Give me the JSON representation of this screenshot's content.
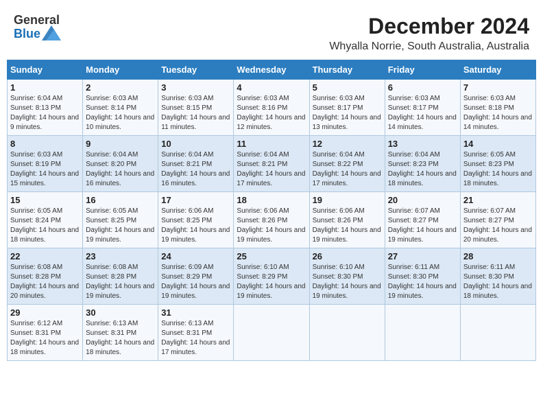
{
  "header": {
    "logo_general": "General",
    "logo_blue": "Blue",
    "month": "December 2024",
    "location": "Whyalla Norrie, South Australia, Australia"
  },
  "weekdays": [
    "Sunday",
    "Monday",
    "Tuesday",
    "Wednesday",
    "Thursday",
    "Friday",
    "Saturday"
  ],
  "weeks": [
    [
      {
        "day": "1",
        "sunrise": "Sunrise: 6:04 AM",
        "sunset": "Sunset: 8:13 PM",
        "daylight": "Daylight: 14 hours and 9 minutes."
      },
      {
        "day": "2",
        "sunrise": "Sunrise: 6:03 AM",
        "sunset": "Sunset: 8:14 PM",
        "daylight": "Daylight: 14 hours and 10 minutes."
      },
      {
        "day": "3",
        "sunrise": "Sunrise: 6:03 AM",
        "sunset": "Sunset: 8:15 PM",
        "daylight": "Daylight: 14 hours and 11 minutes."
      },
      {
        "day": "4",
        "sunrise": "Sunrise: 6:03 AM",
        "sunset": "Sunset: 8:16 PM",
        "daylight": "Daylight: 14 hours and 12 minutes."
      },
      {
        "day": "5",
        "sunrise": "Sunrise: 6:03 AM",
        "sunset": "Sunset: 8:17 PM",
        "daylight": "Daylight: 14 hours and 13 minutes."
      },
      {
        "day": "6",
        "sunrise": "Sunrise: 6:03 AM",
        "sunset": "Sunset: 8:17 PM",
        "daylight": "Daylight: 14 hours and 14 minutes."
      },
      {
        "day": "7",
        "sunrise": "Sunrise: 6:03 AM",
        "sunset": "Sunset: 8:18 PM",
        "daylight": "Daylight: 14 hours and 14 minutes."
      }
    ],
    [
      {
        "day": "8",
        "sunrise": "Sunrise: 6:03 AM",
        "sunset": "Sunset: 8:19 PM",
        "daylight": "Daylight: 14 hours and 15 minutes."
      },
      {
        "day": "9",
        "sunrise": "Sunrise: 6:04 AM",
        "sunset": "Sunset: 8:20 PM",
        "daylight": "Daylight: 14 hours and 16 minutes."
      },
      {
        "day": "10",
        "sunrise": "Sunrise: 6:04 AM",
        "sunset": "Sunset: 8:21 PM",
        "daylight": "Daylight: 14 hours and 16 minutes."
      },
      {
        "day": "11",
        "sunrise": "Sunrise: 6:04 AM",
        "sunset": "Sunset: 8:21 PM",
        "daylight": "Daylight: 14 hours and 17 minutes."
      },
      {
        "day": "12",
        "sunrise": "Sunrise: 6:04 AM",
        "sunset": "Sunset: 8:22 PM",
        "daylight": "Daylight: 14 hours and 17 minutes."
      },
      {
        "day": "13",
        "sunrise": "Sunrise: 6:04 AM",
        "sunset": "Sunset: 8:23 PM",
        "daylight": "Daylight: 14 hours and 18 minutes."
      },
      {
        "day": "14",
        "sunrise": "Sunrise: 6:05 AM",
        "sunset": "Sunset: 8:23 PM",
        "daylight": "Daylight: 14 hours and 18 minutes."
      }
    ],
    [
      {
        "day": "15",
        "sunrise": "Sunrise: 6:05 AM",
        "sunset": "Sunset: 8:24 PM",
        "daylight": "Daylight: 14 hours and 18 minutes."
      },
      {
        "day": "16",
        "sunrise": "Sunrise: 6:05 AM",
        "sunset": "Sunset: 8:25 PM",
        "daylight": "Daylight: 14 hours and 19 minutes."
      },
      {
        "day": "17",
        "sunrise": "Sunrise: 6:06 AM",
        "sunset": "Sunset: 8:25 PM",
        "daylight": "Daylight: 14 hours and 19 minutes."
      },
      {
        "day": "18",
        "sunrise": "Sunrise: 6:06 AM",
        "sunset": "Sunset: 8:26 PM",
        "daylight": "Daylight: 14 hours and 19 minutes."
      },
      {
        "day": "19",
        "sunrise": "Sunrise: 6:06 AM",
        "sunset": "Sunset: 8:26 PM",
        "daylight": "Daylight: 14 hours and 19 minutes."
      },
      {
        "day": "20",
        "sunrise": "Sunrise: 6:07 AM",
        "sunset": "Sunset: 8:27 PM",
        "daylight": "Daylight: 14 hours and 19 minutes."
      },
      {
        "day": "21",
        "sunrise": "Sunrise: 6:07 AM",
        "sunset": "Sunset: 8:27 PM",
        "daylight": "Daylight: 14 hours and 20 minutes."
      }
    ],
    [
      {
        "day": "22",
        "sunrise": "Sunrise: 6:08 AM",
        "sunset": "Sunset: 8:28 PM",
        "daylight": "Daylight: 14 hours and 20 minutes."
      },
      {
        "day": "23",
        "sunrise": "Sunrise: 6:08 AM",
        "sunset": "Sunset: 8:28 PM",
        "daylight": "Daylight: 14 hours and 19 minutes."
      },
      {
        "day": "24",
        "sunrise": "Sunrise: 6:09 AM",
        "sunset": "Sunset: 8:29 PM",
        "daylight": "Daylight: 14 hours and 19 minutes."
      },
      {
        "day": "25",
        "sunrise": "Sunrise: 6:10 AM",
        "sunset": "Sunset: 8:29 PM",
        "daylight": "Daylight: 14 hours and 19 minutes."
      },
      {
        "day": "26",
        "sunrise": "Sunrise: 6:10 AM",
        "sunset": "Sunset: 8:30 PM",
        "daylight": "Daylight: 14 hours and 19 minutes."
      },
      {
        "day": "27",
        "sunrise": "Sunrise: 6:11 AM",
        "sunset": "Sunset: 8:30 PM",
        "daylight": "Daylight: 14 hours and 19 minutes."
      },
      {
        "day": "28",
        "sunrise": "Sunrise: 6:11 AM",
        "sunset": "Sunset: 8:30 PM",
        "daylight": "Daylight: 14 hours and 18 minutes."
      }
    ],
    [
      {
        "day": "29",
        "sunrise": "Sunrise: 6:12 AM",
        "sunset": "Sunset: 8:31 PM",
        "daylight": "Daylight: 14 hours and 18 minutes."
      },
      {
        "day": "30",
        "sunrise": "Sunrise: 6:13 AM",
        "sunset": "Sunset: 8:31 PM",
        "daylight": "Daylight: 14 hours and 18 minutes."
      },
      {
        "day": "31",
        "sunrise": "Sunrise: 6:13 AM",
        "sunset": "Sunset: 8:31 PM",
        "daylight": "Daylight: 14 hours and 17 minutes."
      },
      null,
      null,
      null,
      null
    ]
  ]
}
